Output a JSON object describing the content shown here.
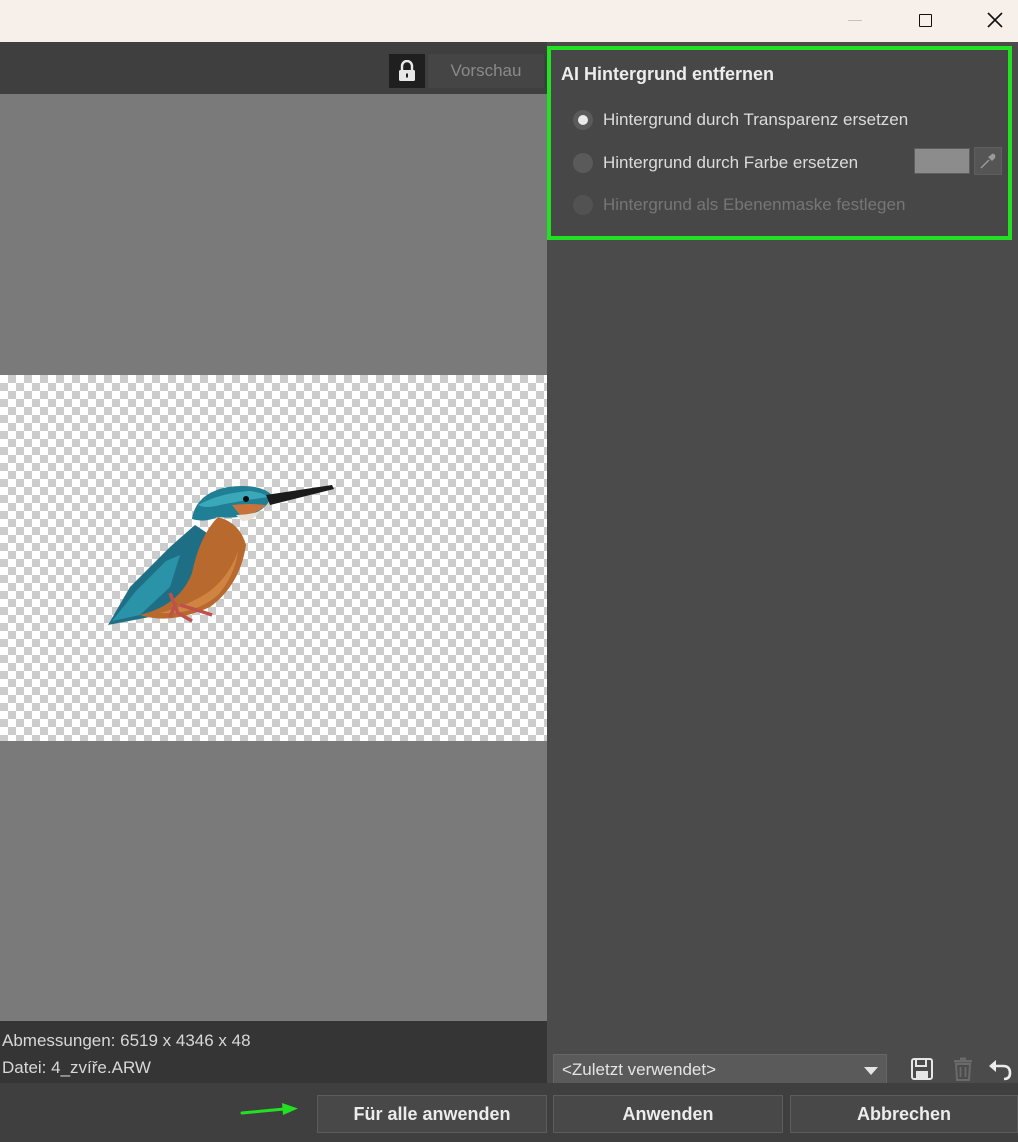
{
  "colors": {
    "highlight_border": "#22e022",
    "arrow": "#22e022",
    "panel_bg": "#4b4b4b",
    "canvas_bg": "#7a7a7a"
  },
  "titlebar": {
    "minimize_icon": "minimize-icon",
    "maximize_icon": "maximize-icon",
    "close_icon": "close-icon"
  },
  "toolbar": {
    "lock_icon": "lock-icon",
    "preview_label": "Vorschau"
  },
  "info": {
    "dimensions": "Abmessungen: 6519 x 4346 x 48",
    "file": "Datei: 4_zvíře.ARW"
  },
  "panel": {
    "title": "AI Hintergrund entfernen",
    "options": [
      {
        "label": "Hintergrund durch Transparenz ersetzen",
        "selected": true,
        "enabled": true
      },
      {
        "label": "Hintergrund durch Farbe ersetzen",
        "selected": false,
        "enabled": true
      },
      {
        "label": "Hintergrund als Ebenenmaske festlegen",
        "selected": false,
        "enabled": false
      }
    ],
    "color_swatch": "#8c8c8c",
    "eyedropper_icon": "eyedropper-icon"
  },
  "preset": {
    "selected": "<Zuletzt verwendet>",
    "save_icon": "save-icon",
    "delete_icon": "trash-icon",
    "reset_icon": "undo-icon"
  },
  "buttons": {
    "apply_all": "Für alle anwenden",
    "apply": "Anwenden",
    "cancel": "Abbrechen"
  }
}
